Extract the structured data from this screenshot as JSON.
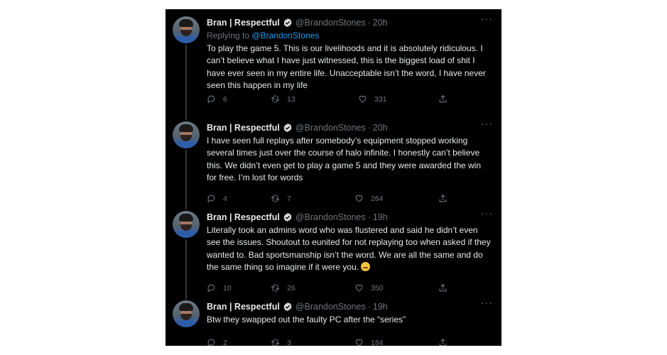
{
  "tweets": [
    {
      "name": "Bran | Respectful",
      "handle": "@BrandonStones",
      "time": "20h",
      "replying_label": "Replying to ",
      "replying_handle": "@BrandonStones",
      "text": "To play the game 5. This is our livelihoods and it is absolutely ridiculous. I can’t believe what I have just witnessed, this is the biggest load of shit I have ever seen in my entire life. Unacceptable isn’t the word, I have never seen this happen in my life",
      "replies": "6",
      "retweets": "13",
      "likes": "331"
    },
    {
      "name": "Bran | Respectful",
      "handle": "@BrandonStones",
      "time": "20h",
      "text": "I have seen full replays after somebody’s equipment stopped working several times just over the course of halo infinite. I honestly can’t believe this. We didn’t even get to play a game 5 and they were awarded the win for free. I’m lost for words",
      "replies": "4",
      "retweets": "7",
      "likes": "264"
    },
    {
      "name": "Bran | Respectful",
      "handle": "@BrandonStones",
      "time": "19h",
      "text": "Literally took an admins word who was flustered and said he didn’t even see the issues. Shoutout to eunited for not replaying too when asked if they wanted to. Bad sportsmanship isn’t the word. We are all the same and do the same thing so imagine if it were you.",
      "emoji": "relieved-face-emoji",
      "replies": "10",
      "retweets": "26",
      "likes": "350"
    },
    {
      "name": "Bran | Respectful",
      "handle": "@BrandonStones",
      "time": "19h",
      "text": "Btw they swapped out the faulty PC after the “series”",
      "replies": "2",
      "retweets": "3",
      "likes": "184"
    }
  ],
  "colors": {
    "background": "#000000",
    "text": "#e7e9ea",
    "secondary": "#71767b",
    "link": "#1d9bf0",
    "verified": "#1d9bf0"
  },
  "icons": [
    "verified-badge-icon",
    "more-icon",
    "reply-icon",
    "retweet-icon",
    "like-icon",
    "share-icon"
  ]
}
